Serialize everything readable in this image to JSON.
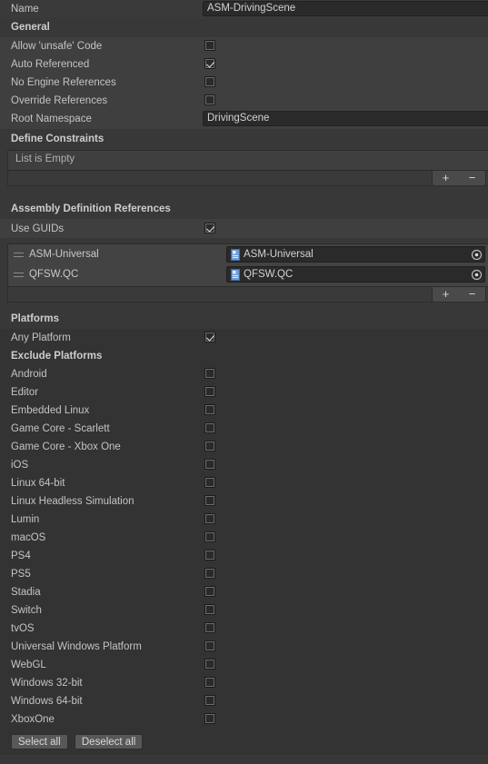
{
  "name_row": {
    "label": "Name",
    "value": "ASM-DrivingScene"
  },
  "general": {
    "header": "General",
    "options": [
      {
        "label": "Allow 'unsafe' Code",
        "checked": false
      },
      {
        "label": "Auto Referenced",
        "checked": true
      },
      {
        "label": "No Engine References",
        "checked": false
      },
      {
        "label": "Override References",
        "checked": false
      }
    ],
    "root_namespace": {
      "label": "Root Namespace",
      "value": "DrivingScene"
    }
  },
  "define_constraints": {
    "header": "Define Constraints",
    "empty_text": "List is Empty",
    "add_label": "+",
    "remove_label": "−"
  },
  "assembly_definition_references": {
    "header": "Assembly Definition References",
    "use_guids": {
      "label": "Use GUIDs",
      "checked": true
    },
    "items": [
      {
        "name": "ASM-Universal",
        "object_value": "ASM-Universal"
      },
      {
        "name": "QFSW.QC",
        "object_value": "QFSW.QC"
      }
    ],
    "add_label": "+",
    "remove_label": "−"
  },
  "platforms": {
    "header": "Platforms",
    "any_platform": {
      "label": "Any Platform",
      "checked": true
    },
    "exclude_header": "Exclude Platforms",
    "list": [
      {
        "label": "Android",
        "checked": false
      },
      {
        "label": "Editor",
        "checked": false
      },
      {
        "label": "Embedded Linux",
        "checked": false
      },
      {
        "label": "Game Core - Scarlett",
        "checked": false
      },
      {
        "label": "Game Core - Xbox One",
        "checked": false
      },
      {
        "label": "iOS",
        "checked": false
      },
      {
        "label": "Linux 64-bit",
        "checked": false
      },
      {
        "label": "Linux Headless Simulation",
        "checked": false
      },
      {
        "label": "Lumin",
        "checked": false
      },
      {
        "label": "macOS",
        "checked": false
      },
      {
        "label": "PS4",
        "checked": false
      },
      {
        "label": "PS5",
        "checked": false
      },
      {
        "label": "Stadia",
        "checked": false
      },
      {
        "label": "Switch",
        "checked": false
      },
      {
        "label": "tvOS",
        "checked": false
      },
      {
        "label": "Universal Windows Platform",
        "checked": false
      },
      {
        "label": "WebGL",
        "checked": false
      },
      {
        "label": "Windows 32-bit",
        "checked": false
      },
      {
        "label": "Windows 64-bit",
        "checked": false
      },
      {
        "label": "XboxOne",
        "checked": false
      }
    ],
    "select_all": "Select all",
    "deselect_all": "Deselect all"
  },
  "colors": {
    "window_bg": "#383838",
    "band_light": "#3f3f3f",
    "field_bg": "#2a2a2a",
    "text": "#c4c4c4",
    "icon_blue": "#6f9fd8"
  }
}
